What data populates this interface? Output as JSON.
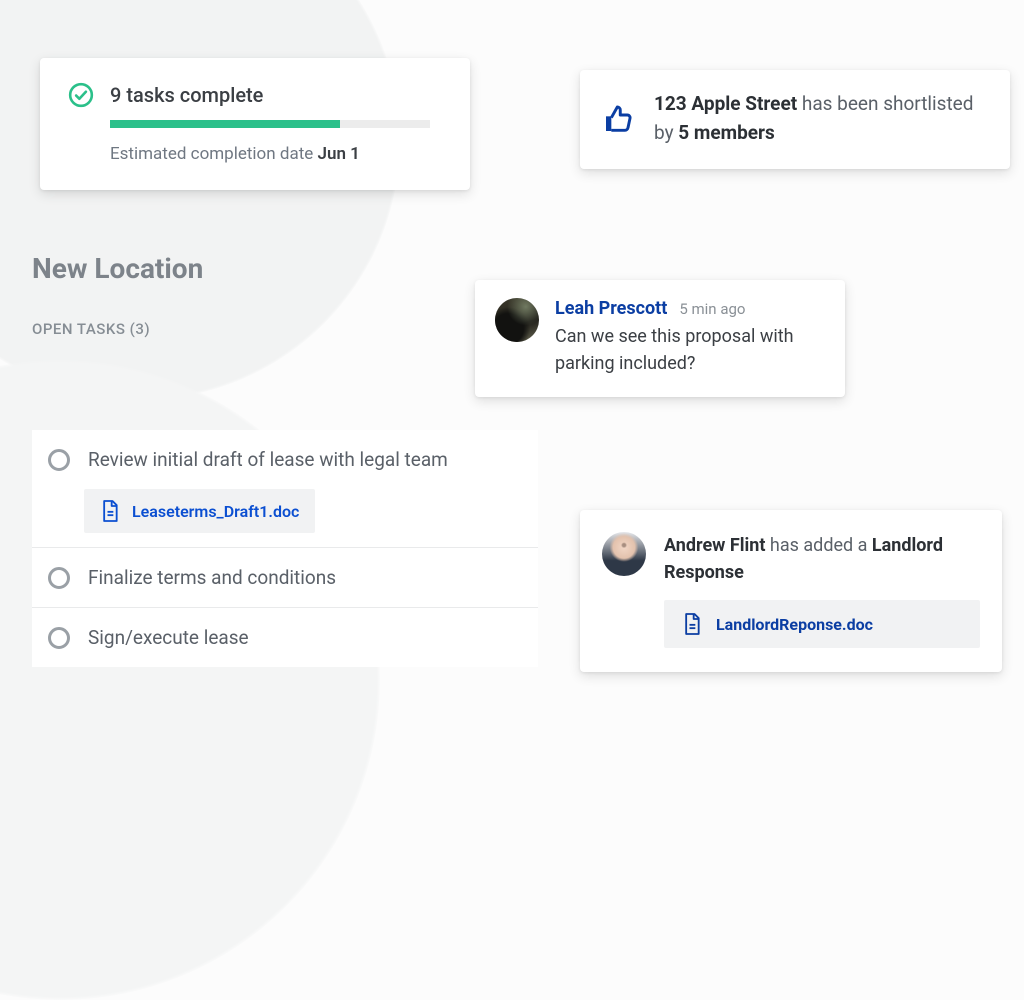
{
  "progress": {
    "title": "9 tasks complete",
    "est_prefix": "Estimated completion date ",
    "est_date": "Jun 1",
    "percent": 72
  },
  "shortlist": {
    "address": "123 Apple Street",
    "mid": " has been shortlisted by ",
    "count": "5 members"
  },
  "section_title": "New Location",
  "open_tasks_label": "OPEN TASKS (3)",
  "comment": {
    "name": "Leah Prescott",
    "time": "5 min ago",
    "body": "Can we see this proposal with parking included?"
  },
  "tasks": [
    {
      "label": "Review initial draft of lease with legal team",
      "attachment": "Leaseterms_Draft1.doc"
    },
    {
      "label": "Finalize terms and conditions"
    },
    {
      "label": "Sign/execute lease"
    }
  ],
  "landlord": {
    "person": "Andrew Flint",
    "mid": " has added a ",
    "object": "Landlord Response",
    "file": "LandlordReponse.doc"
  }
}
